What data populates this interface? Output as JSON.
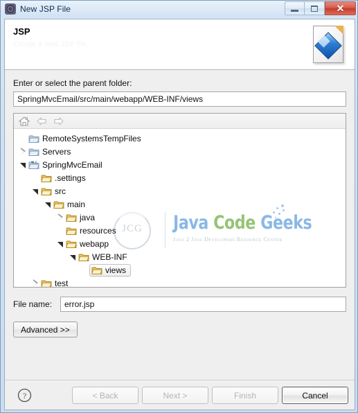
{
  "window": {
    "title": "New JSP File",
    "icon": "eclipse-gear-icon",
    "controls": {
      "minimize": "minimize-button",
      "maximize": "maximize-button",
      "close": "✕"
    }
  },
  "header": {
    "title": "JSP",
    "description": "Create a new JSP file.",
    "icon": "jsp-file-icon"
  },
  "form": {
    "parent_folder_label": "Enter or select the parent folder:",
    "parent_folder_value": "SpringMvcEmail/src/main/webapp/WEB-INF/views",
    "parent_folder_placeholder": "",
    "file_name_label": "File name:",
    "file_name_value": "error.jsp",
    "file_name_placeholder": "",
    "advanced_label": "Advanced >>"
  },
  "tree_toolbar": {
    "home": "home-icon",
    "back": "back-arrow-icon",
    "forward": "forward-arrow-icon"
  },
  "tree": {
    "nodes": [
      {
        "label": "RemoteSystemsTempFiles",
        "depth": 1,
        "twisty": "none",
        "icon": "folder-blue",
        "selected": false
      },
      {
        "label": "Servers",
        "depth": 1,
        "twisty": "collapsed",
        "icon": "folder-blue",
        "selected": false
      },
      {
        "label": "SpringMvcEmail",
        "depth": 1,
        "twisty": "expanded",
        "icon": "folder-maven",
        "selected": false
      },
      {
        "label": ".settings",
        "depth": 2,
        "twisty": "none",
        "icon": "folder-yellow",
        "selected": false
      },
      {
        "label": "src",
        "depth": 2,
        "twisty": "expanded",
        "icon": "folder-yellow",
        "selected": false
      },
      {
        "label": "main",
        "depth": 3,
        "twisty": "expanded",
        "icon": "folder-yellow",
        "selected": false
      },
      {
        "label": "java",
        "depth": 4,
        "twisty": "collapsed",
        "icon": "folder-yellow",
        "selected": false
      },
      {
        "label": "resources",
        "depth": 4,
        "twisty": "none",
        "icon": "folder-yellow",
        "selected": false
      },
      {
        "label": "webapp",
        "depth": 4,
        "twisty": "expanded",
        "icon": "folder-yellow",
        "selected": false
      },
      {
        "label": "WEB-INF",
        "depth": 5,
        "twisty": "expanded",
        "icon": "folder-yellow",
        "selected": false
      },
      {
        "label": "views",
        "depth": 6,
        "twisty": "none",
        "icon": "folder-yellow",
        "selected": true
      },
      {
        "label": "test",
        "depth": 2,
        "twisty": "collapsed",
        "icon": "folder-yellow",
        "selected": false
      }
    ]
  },
  "watermark": {
    "mark": "JCG",
    "word1": "Java",
    "word2": "Code",
    "word3": "Geeks",
    "subtitle": "Java 2 Java Developers Resource Center",
    "color_blue": "#7fb3e3",
    "color_green": "#8cbf6a"
  },
  "buttons": {
    "help": "?",
    "back": "< Back",
    "next": "Next >",
    "finish": "Finish",
    "cancel": "Cancel"
  }
}
